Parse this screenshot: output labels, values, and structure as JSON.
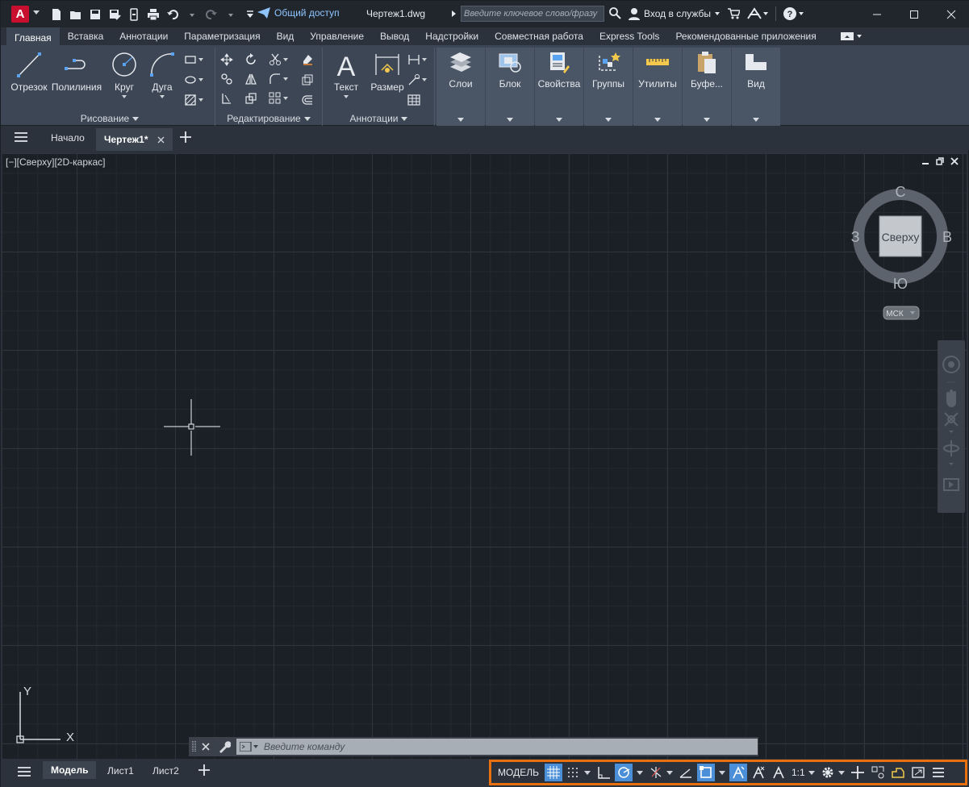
{
  "app": {
    "logo_letter": "A",
    "share_label": "Общий доступ",
    "document_title": "Чертеж1.dwg",
    "search_placeholder": "Введите ключевое слово/фразу",
    "signin_label": "Вход в службы"
  },
  "ribbon_tabs": [
    "Главная",
    "Вставка",
    "Аннотации",
    "Параметризация",
    "Вид",
    "Управление",
    "Вывод",
    "Надстройки",
    "Совместная работа",
    "Express Tools",
    "Рекомендованные приложения"
  ],
  "ribbon": {
    "draw": {
      "title": "Рисование",
      "buttons": [
        "Отрезок",
        "Полилиния",
        "Круг",
        "Дуга"
      ]
    },
    "modify": {
      "title": "Редактирование"
    },
    "annotation": {
      "title": "Аннотации",
      "buttons": [
        "Текст",
        "Размер"
      ]
    },
    "panels": [
      "Слои",
      "Блок",
      "Свойства",
      "Группы",
      "Утилиты",
      "Буфе...",
      "Вид"
    ]
  },
  "doc_tabs": {
    "start": "Начало",
    "drawing": "Чертеж1*"
  },
  "viewport": {
    "label": "[−][Сверху][2D-каркас]",
    "viewcube": {
      "north": "С",
      "south": "Ю",
      "east": "В",
      "west": "З",
      "face": "Сверху",
      "ucs_button": "МСК"
    },
    "ucs_axes": {
      "y": "Y",
      "x": "X"
    }
  },
  "command_line": {
    "placeholder": "Введите команду"
  },
  "layout_tabs": [
    "Модель",
    "Лист1",
    "Лист2"
  ],
  "status_bar": {
    "model_label": "МОДЕЛЬ",
    "scale_label": "1:1"
  },
  "colors": {
    "accent": "#4a8fd8",
    "highlight_border": "#e8700f",
    "logo": "#c8102e"
  }
}
